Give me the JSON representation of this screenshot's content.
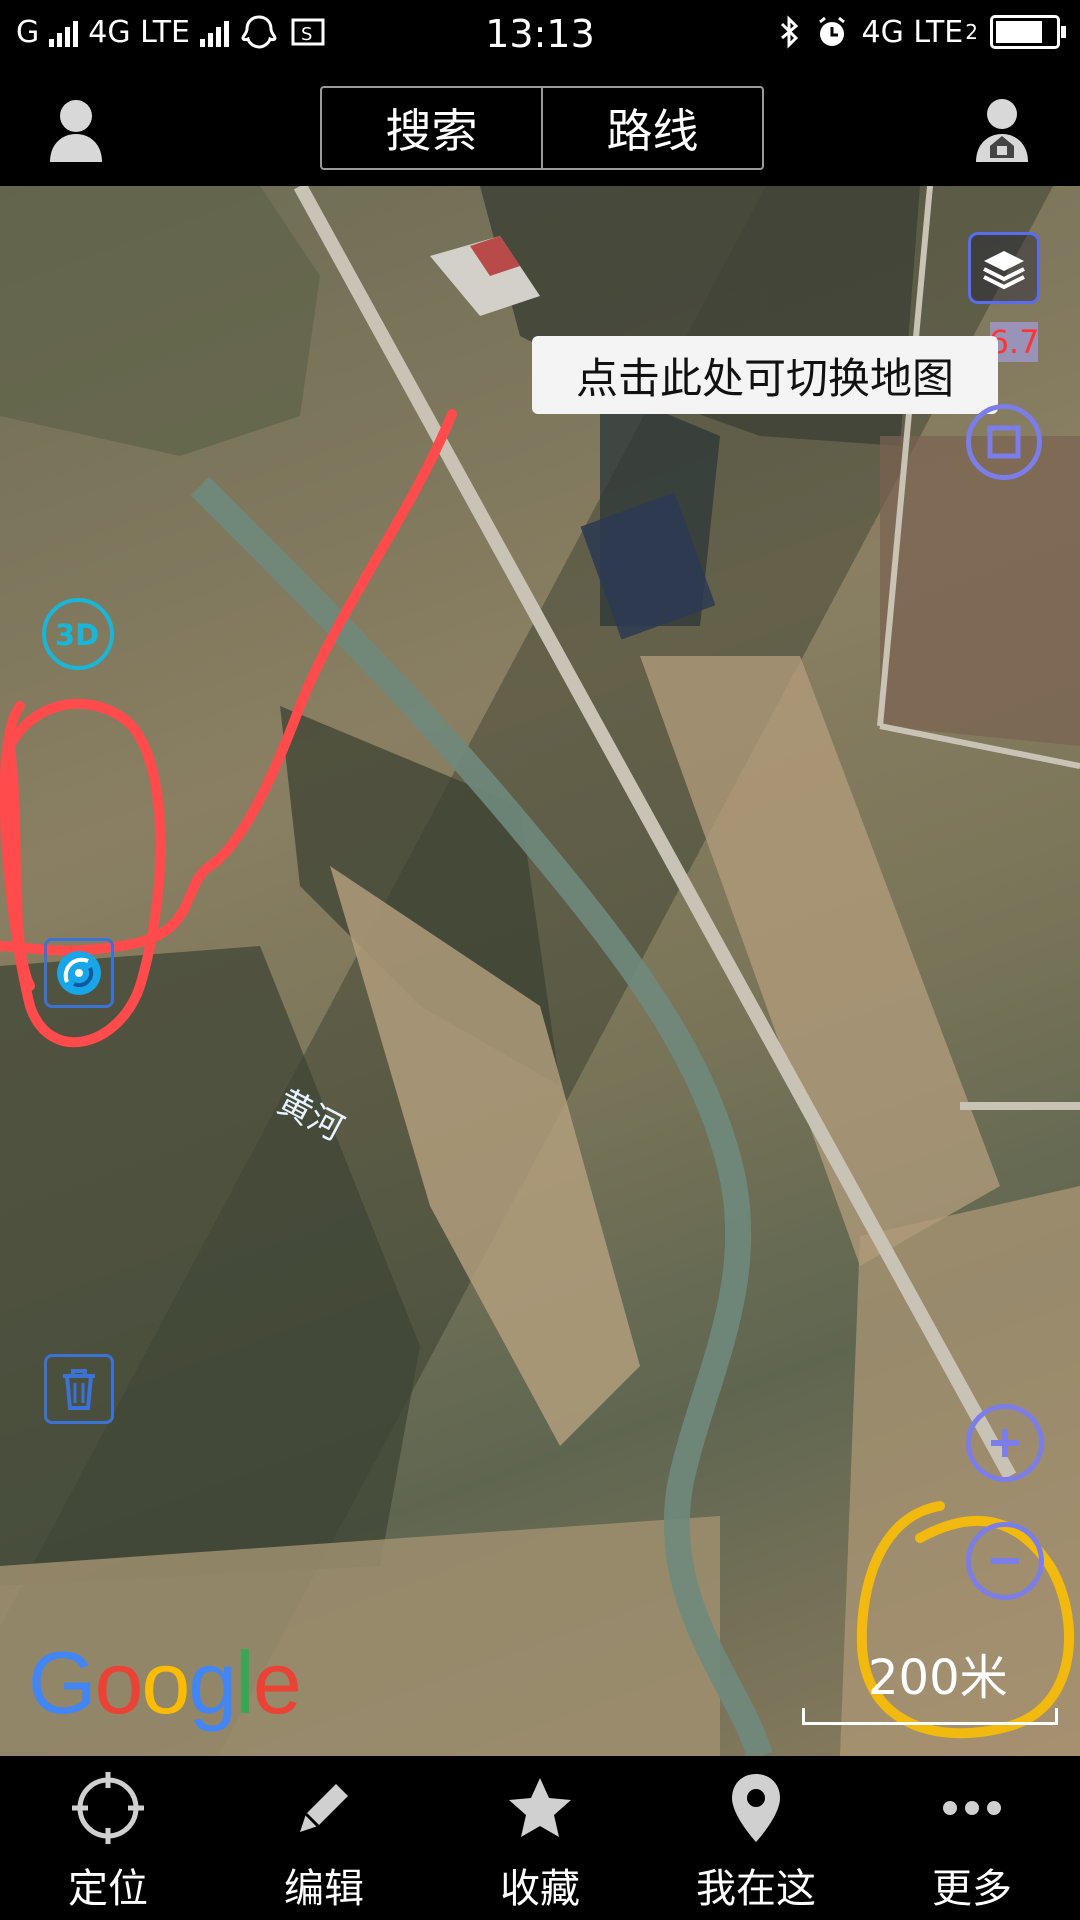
{
  "status_bar": {
    "carrier_left": "G",
    "network_1": "4G LTE",
    "time": "13:13",
    "network_2": "4G LTE",
    "network_2_sub": "2",
    "battery_level": 0.8
  },
  "header": {
    "tabs": [
      {
        "label": "搜索"
      },
      {
        "label": "路线"
      }
    ],
    "left_icon": "user-avatar-icon",
    "right_icon": "home-lock-icon"
  },
  "map": {
    "tooltip": "点击此处可切换地图",
    "badge_text": "6.7",
    "river_label": "黄河",
    "logo": "Google",
    "scale_label": "200米",
    "controls": [
      "layers-icon",
      "square-select-icon",
      "3d-toggle",
      "navigation-sync-icon",
      "trash-icon",
      "zoom-in-icon",
      "zoom-out-icon"
    ],
    "annotation_colors": {
      "red": "#ff4b4b",
      "yellow": "#f2b90f"
    },
    "control_color": "#5a6cf0"
  },
  "bottom_nav": [
    {
      "label": "定位",
      "icon": "locate-crosshair-icon"
    },
    {
      "label": "编辑",
      "icon": "pencil-icon"
    },
    {
      "label": "收藏",
      "icon": "star-icon"
    },
    {
      "label": "我在这",
      "icon": "map-pin-icon"
    },
    {
      "label": "更多",
      "icon": "more-dots-icon"
    }
  ]
}
